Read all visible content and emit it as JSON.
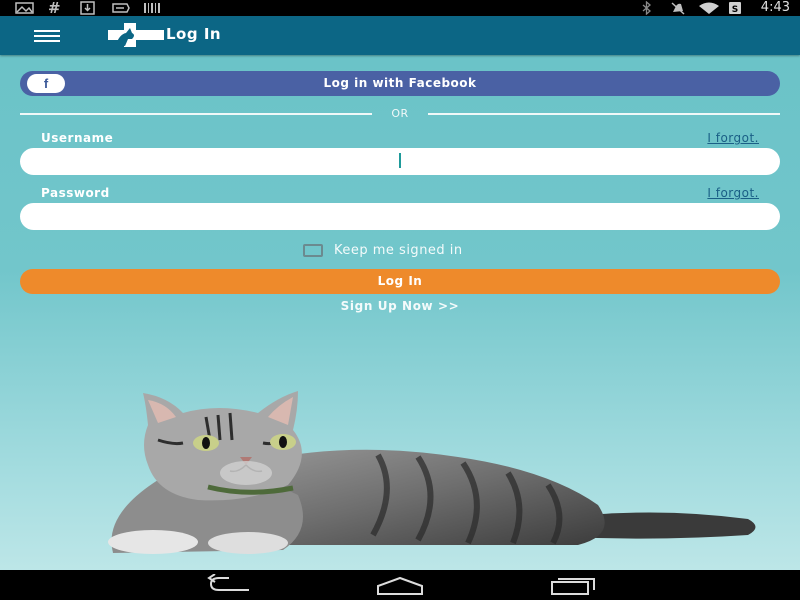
{
  "status_bar": {
    "time": "4:43",
    "left_icons": [
      "gallery-icon",
      "hash-icon",
      "download-icon",
      "direction-icon",
      "barcode-icon"
    ],
    "right_icons": [
      "bluetooth-icon",
      "mute-icon",
      "wifi-icon",
      "battery-icon"
    ]
  },
  "app_bar": {
    "title": "Log In",
    "menu_icon": "hamburger-menu-icon",
    "logo_icon": "vet-cross-logo-icon",
    "background": "#0c6685"
  },
  "facebook_button": {
    "icon_letter": "f",
    "label": "Log in with Facebook",
    "background": "#4a61a4"
  },
  "divider": {
    "text": "OR"
  },
  "username": {
    "label": "Username",
    "forgot_label": "I forgot.",
    "value": "",
    "placeholder": ""
  },
  "password": {
    "label": "Password",
    "forgot_label": "I forgot.",
    "value": "",
    "placeholder": ""
  },
  "keep_signed_in": {
    "label": "Keep me signed in",
    "checked": false
  },
  "login_button": {
    "label": "Log In",
    "background": "#ee8a2b"
  },
  "signup": {
    "label": "Sign Up Now >>"
  },
  "navigation_bar": {
    "icons": [
      "back-icon",
      "home-icon",
      "recents-icon"
    ]
  },
  "colors": {
    "background": "#6cc3c8",
    "link": "#1a5f86"
  }
}
